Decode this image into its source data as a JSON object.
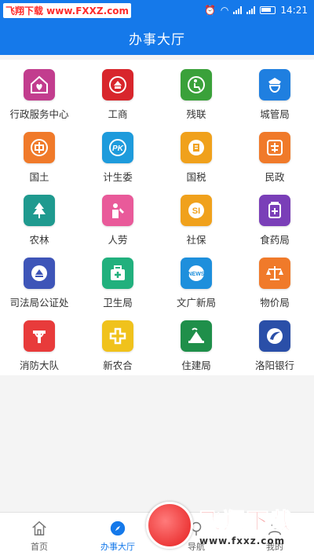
{
  "status_bar": {
    "watermark": "飞翔下载 www.FXXZ.com",
    "time": "14:21"
  },
  "header": {
    "title": "办事大厅"
  },
  "services": [
    {
      "label": "行政服务中心",
      "color": "#c23d8e",
      "icon": "house-heart-icon"
    },
    {
      "label": "工商",
      "color": "#d8262c",
      "icon": "emblem-icon"
    },
    {
      "label": "残联",
      "color": "#3aa13a",
      "icon": "disability-icon"
    },
    {
      "label": "城管局",
      "color": "#1f7fe0",
      "icon": "badge-icon"
    },
    {
      "label": "国土",
      "color": "#f07a2a",
      "icon": "land-icon"
    },
    {
      "label": "计生委",
      "color": "#1e9bdc",
      "icon": "family-icon"
    },
    {
      "label": "国税",
      "color": "#f0a11c",
      "icon": "tax-icon"
    },
    {
      "label": "民政",
      "color": "#f07a2a",
      "icon": "civil-icon"
    },
    {
      "label": "农林",
      "color": "#1f9a8f",
      "icon": "tree-icon"
    },
    {
      "label": "人劳",
      "color": "#e95a9a",
      "icon": "worker-icon"
    },
    {
      "label": "社保",
      "color": "#f0a11c",
      "icon": "social-security-icon"
    },
    {
      "label": "食药局",
      "color": "#7a3fb8",
      "icon": "medicine-icon"
    },
    {
      "label": "司法局公证处",
      "color": "#3e55b8",
      "icon": "justice-icon"
    },
    {
      "label": "卫生局",
      "color": "#21b07d",
      "icon": "medical-kit-icon"
    },
    {
      "label": "文广新局",
      "color": "#1e8fdc",
      "icon": "news-globe-icon"
    },
    {
      "label": "物价局",
      "color": "#f07a2a",
      "icon": "scale-icon"
    },
    {
      "label": "消防大队",
      "color": "#e83b3b",
      "icon": "fire-icon"
    },
    {
      "label": "新农合",
      "color": "#f0c21c",
      "icon": "cross-plus-icon"
    },
    {
      "label": "住建局",
      "color": "#1f8f4a",
      "icon": "building-icon"
    },
    {
      "label": "洛阳银行",
      "color": "#2a4fa8",
      "icon": "bank-icon"
    }
  ],
  "nav": {
    "items": [
      {
        "label": "首页",
        "icon": "home-icon"
      },
      {
        "label": "办事大厅",
        "icon": "compass-icon"
      },
      {
        "label": "导航",
        "icon": "navigation-icon"
      },
      {
        "label": "我的",
        "icon": "profile-icon"
      }
    ],
    "active_index": 1
  },
  "watermark_logo": {
    "title": "飞翔下载",
    "url": "www.fxxz.com"
  }
}
